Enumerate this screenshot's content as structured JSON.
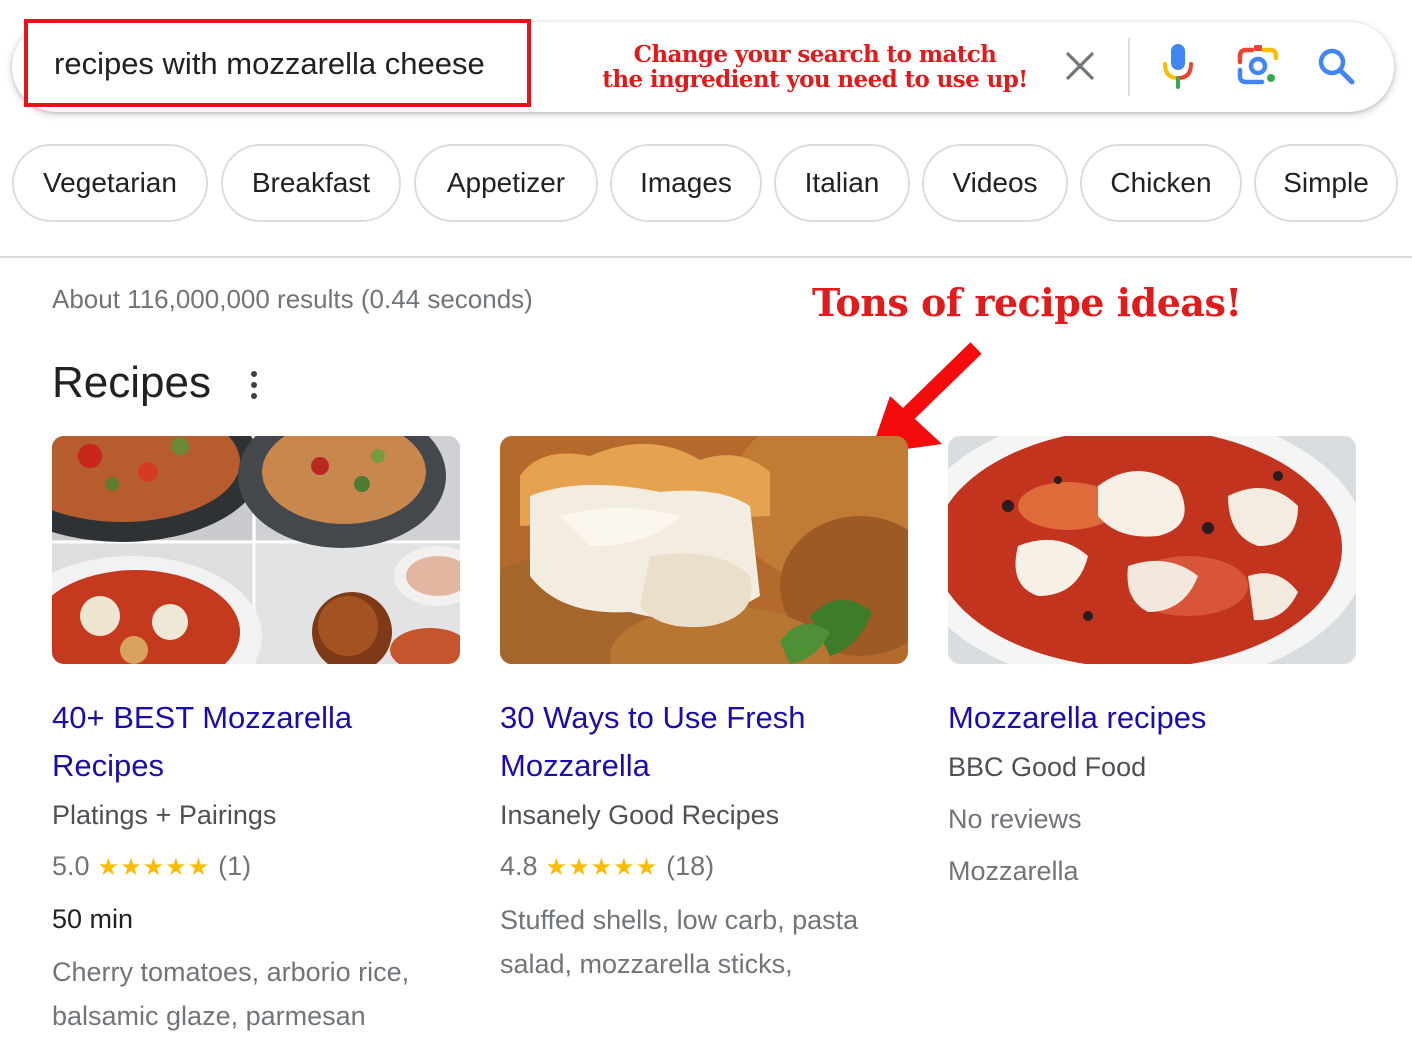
{
  "search": {
    "query": "recipes with mozzarella cheese",
    "annotation_line1": "Change your search to match",
    "annotation_line2": "the ingredient you need to use up!"
  },
  "icons": {
    "clear": "close-icon",
    "voice": "microphone-icon",
    "lens": "camera-lens-icon",
    "search": "search-icon"
  },
  "chips": [
    "Vegetarian",
    "Breakfast",
    "Appetizer",
    "Images",
    "Italian",
    "Videos",
    "Chicken",
    "Simple"
  ],
  "results_stats": "About 116,000,000 results (0.44 seconds)",
  "annotation_tons": "Tons of recipe ideas!",
  "section_title": "Recipes",
  "cards": [
    {
      "title_line1": "40+ BEST Mozzarella",
      "title_line2": "Recipes",
      "source": "Platings + Pairings",
      "rating": "5.0",
      "stars": "★★★★★",
      "reviews": "(1)",
      "time": "50 min",
      "ingredients_line1": "Cherry tomatoes, arborio rice,",
      "ingredients_line2": "balsamic glaze, parmesan"
    },
    {
      "title_line1": "30 Ways to Use Fresh",
      "title_line2": "Mozzarella",
      "source": "Insanely Good Recipes",
      "rating": "4.8",
      "stars": "★★★★★",
      "reviews": "(18)",
      "ingredients_line1": "Stuffed shells, low carb, pasta",
      "ingredients_line2": "salad, mozzarella sticks,"
    },
    {
      "title_line1": "Mozzarella recipes",
      "source": "BBC Good Food",
      "reviews_text": "No reviews",
      "category": "Mozzarella"
    }
  ],
  "colors": {
    "link": "#1a0dab",
    "annotation_red": "#e01b1b",
    "star": "#fbbc04",
    "google_blue": "#4285f4",
    "google_red": "#ea4335",
    "google_yellow": "#fbbc04",
    "google_green": "#34a853"
  }
}
